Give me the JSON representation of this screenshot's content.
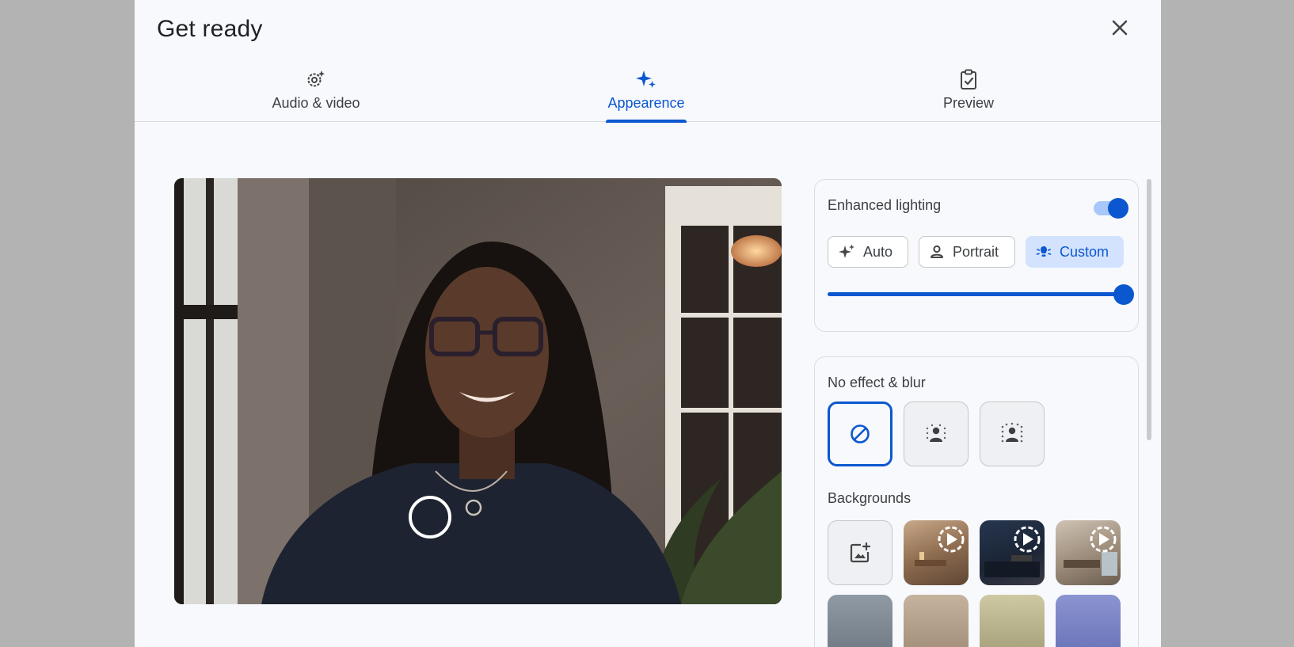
{
  "dialog": {
    "title": "Get ready"
  },
  "tabs": [
    {
      "label": "Audio & video",
      "icon": "settings-sparkle-icon"
    },
    {
      "label": "Appearence",
      "icon": "sparkle-icon"
    },
    {
      "label": "Preview",
      "icon": "clipboard-check-icon"
    }
  ],
  "active_tab": "Appearence",
  "lighting": {
    "label": "Enhanced lighting",
    "enabled": true,
    "modes": [
      {
        "label": "Auto",
        "icon": "sparkle-icon"
      },
      {
        "label": "Portrait",
        "icon": "person-icon"
      },
      {
        "label": "Custom",
        "icon": "light-bulb-icon"
      }
    ],
    "selected_mode": "Custom",
    "intensity": 1.0
  },
  "effects": {
    "label": "No effect & blur",
    "options": [
      "no-effect",
      "slight-blur",
      "blur"
    ],
    "selected": "no-effect"
  },
  "backgrounds": {
    "label": "Backgrounds",
    "items": [
      "upload-background",
      "animated-room-warm",
      "animated-night-city",
      "animated-room-bright"
    ]
  },
  "colors": {
    "accent": "#0b57d0",
    "accent_light": "#d3e3fd",
    "surface": "#f8f9fc",
    "backdrop": "#b3b3b3"
  }
}
